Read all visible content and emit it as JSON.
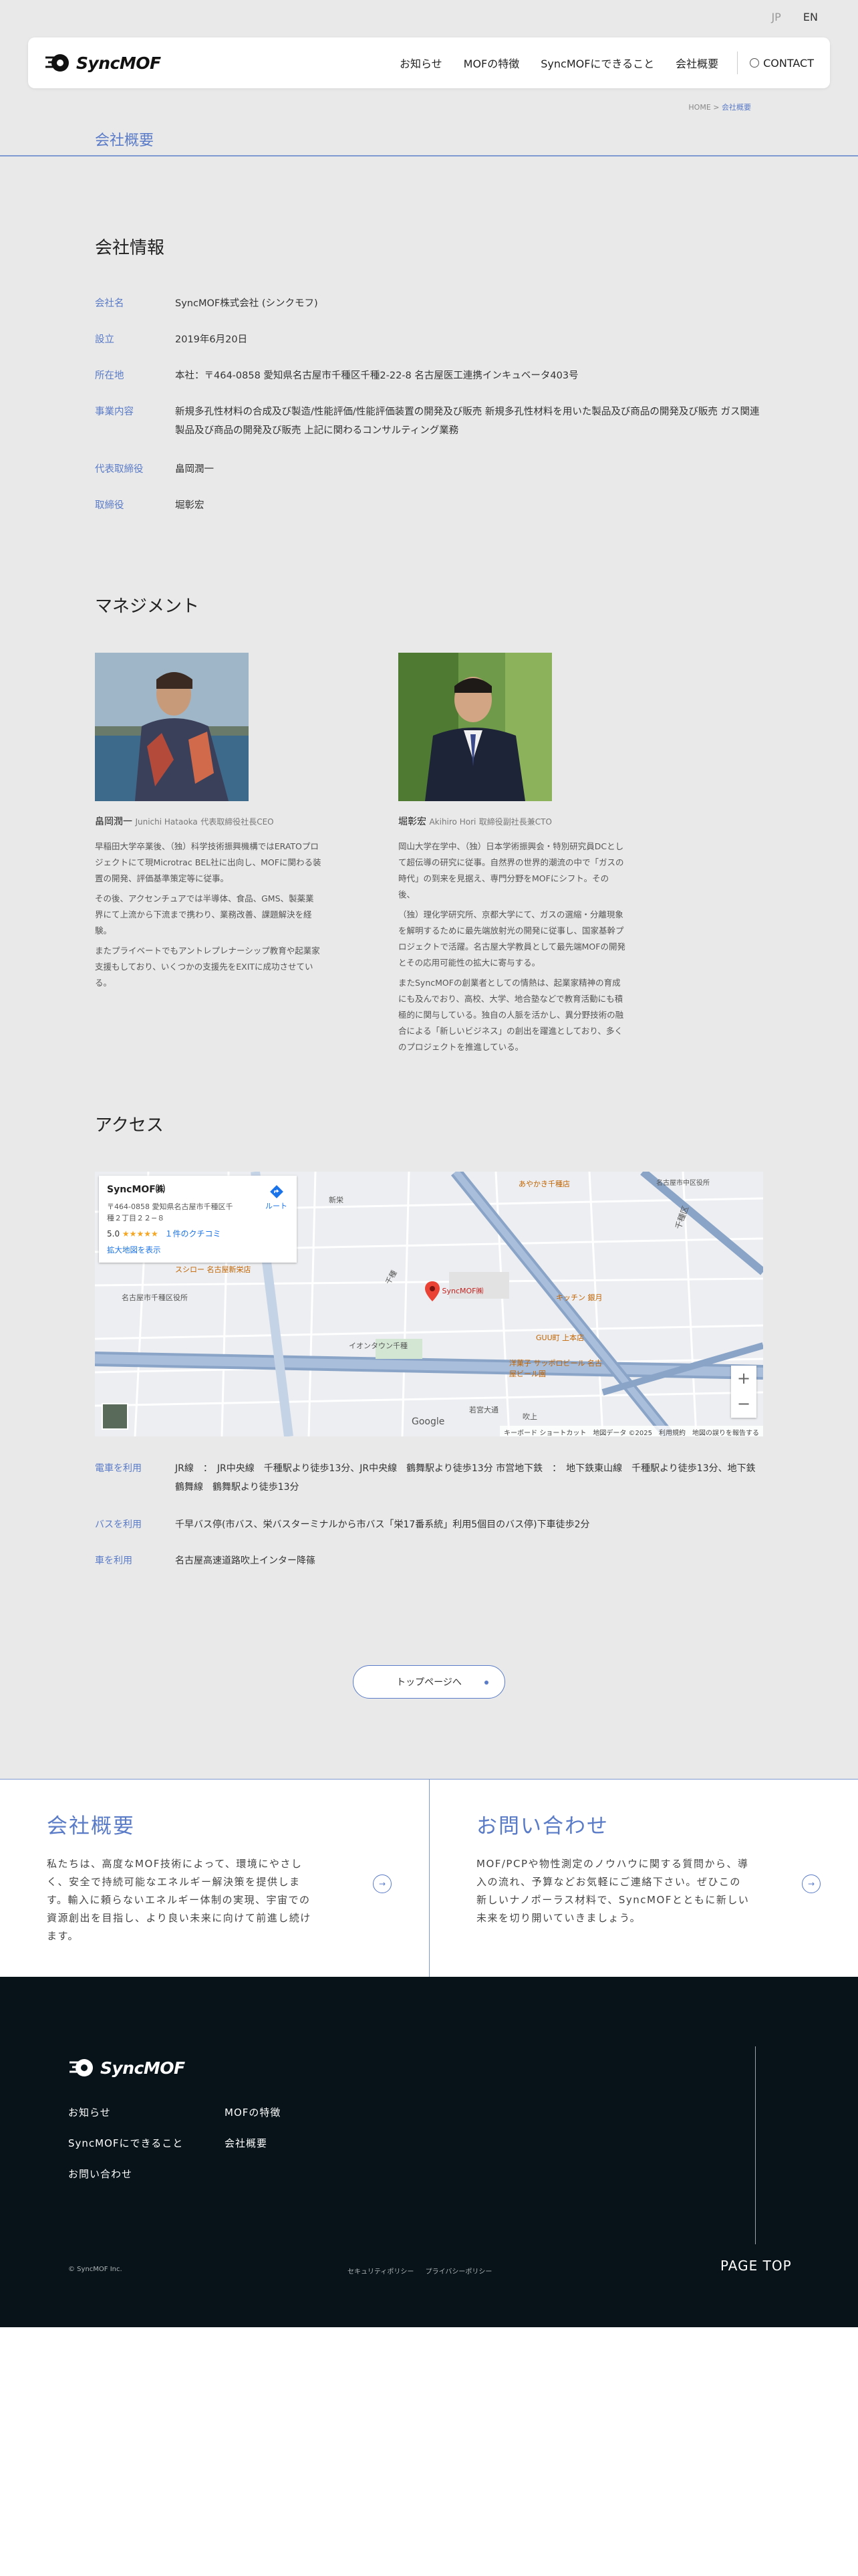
{
  "lang": {
    "jp": "JP",
    "en": "EN"
  },
  "header": {
    "logo_text": "SyncMOF",
    "nav": [
      "お知らせ",
      "MOFの特徴",
      "SyncMOFにできること",
      "会社概要"
    ],
    "contact": "CONTACT"
  },
  "breadcrumb": {
    "home": "HOME",
    "sep": ">",
    "current": "会社概要"
  },
  "page_title": "会社概要",
  "company": {
    "heading": "会社情報",
    "rows": [
      {
        "k": "会社名",
        "v": "SyncMOF株式会社 (シンクモフ)"
      },
      {
        "k": "設立",
        "v": "2019年6月20日"
      },
      {
        "k": "所在地",
        "v": "本社：〒464-0858 愛知県名古屋市千種区千種2-22-8 名古屋医工連携インキュベータ403号"
      },
      {
        "k": "事業内容",
        "v": "新規多孔性材料の合成及び製造/性能評価/性能評価装置の開発及び販売 新規多孔性材料を用いた製品及び商品の開発及び販売 ガス関連製品及び商品の開発及び販売 上記に関わるコンサルティング業務"
      },
      {
        "k": "代表取締役",
        "v": "畠岡潤一"
      },
      {
        "k": "取締役",
        "v": "堀彰宏"
      }
    ]
  },
  "management": {
    "heading": "マネジメント",
    "people": [
      {
        "name": "畠岡潤一",
        "en": "Junichi Hataoka",
        "role": "代表取締役社長CEO",
        "bio": [
          "早稲田大学卒業後、（独）科学技術振興機構ではERATOプロジェクトにて現Microtrac BEL社に出向し、MOFに関わる装置の開発、評価基準策定等に従事。",
          "その後、アクセンチュアでは半導体、食品、GMS、製薬業界にて上流から下流まで携わり、業務改善、課題解決を経験。",
          "またプライベートでもアントレプレナーシップ教育や起業家支援もしており、いくつかの支援先をEXITに成功させている。"
        ]
      },
      {
        "name": "堀彰宏",
        "en": "Akihiro Hori",
        "role": "取締役副社長兼CTO",
        "bio": [
          "岡山大学在学中、（独）日本学術振興会・特別研究員DCとして超伝導の研究に従事。自然界の世界的潮流の中で「ガスの時代」の到来を見据え、専門分野をMOFにシフト。その後、",
          "（独）理化学研究所、京都大学にて、ガスの選縮・分離現象を解明するために最先端放射光の開発に従事し、国家基幹プロジェクトで活躍。名古屋大学教員として最先端MOFの開発とその応用可能性の拡大に寄与する。",
          "またSyncMOFの創業者としての情熱は、起業家精神の育成にも及んでおり、高校、大学、地合塾などで教育活動にも積極的に関与している。独自の人脈を活かし、異分野技術の融合による「新しいビジネス」の創出を躍進としており、多くのプロジェクトを推進している。"
        ]
      }
    ]
  },
  "access": {
    "heading": "アクセス",
    "map": {
      "place": "SyncMOF㈱",
      "address": "〒464-0858 愛知県名古屋市千種区千種２丁目２２−８",
      "rating": "5.0",
      "stars": "★★★★★",
      "reviews": "１件のクチコミ",
      "large_map": "拡大地図を表示",
      "route": "ルート",
      "pin_label": "SyncMOF㈱",
      "labels": [
        "新栄",
        "葵",
        "千種",
        "名古屋市中区役所",
        "千種区",
        "イオンタウン千種",
        "若宮大通",
        "吹上",
        "名古屋市千種区役所",
        "あやかき千種店",
        "キッチン 銀月",
        "GUU町 上本店",
        "スシロー 名古屋新栄店",
        "洋菓子 サッポロビール 名古屋ビール園"
      ],
      "footer": [
        "キーボード ショートカット",
        "地図データ ©2025",
        "利用規約",
        "地図の誤りを報告する"
      ],
      "google": "Google"
    },
    "rows": [
      {
        "k": "電車を利用",
        "v": "JR線　：　JR中央線　千種駅より徒歩13分、JR中央線　鶴舞駅より徒歩13分 市営地下鉄　：　地下鉄東山線　千種駅より徒歩13分、地下鉄鶴舞線　鶴舞駅より徒歩13分"
      },
      {
        "k": "バスを利用",
        "v": "千早バス停(市バス、栄バスターミナルから市バス「栄17番系統」利用5個目のバス停)下車徒歩2分"
      },
      {
        "k": "車を利用",
        "v": "名古屋高速道路吹上インター降篠"
      }
    ]
  },
  "top_button": "トップページへ",
  "cta": [
    {
      "title": "会社概要",
      "desc": "私たちは、高度なMOF技術によって、環境にやさしく、安全で持続可能なエネルギー解決策を提供します。輸入に頼らないエネルギー体制の実現、宇宙での資源創出を目指し、より良い未来に向けて前進し続けます。"
    },
    {
      "title": "お問い合わせ",
      "desc": "MOF/PCPや物性測定のノウハウに関する質問から、導入の流れ、予算などお気軽にご連絡下さい。ぜひこの新しいナノポーラス材料で、SyncMOFとともに新しい未来を切り開いていきましょう。"
    }
  ],
  "footer": {
    "logo_text": "SyncMOF",
    "nav": [
      "お知らせ",
      "MOFの特徴",
      "SyncMOFにできること",
      "会社概要",
      "お問い合わせ"
    ],
    "copyright": "© SyncMOF Inc.",
    "links": [
      "セキュリティポリシー",
      "プライバシーポリシー"
    ],
    "page_top": "PAGE TOP"
  },
  "colors": {
    "accent": "#5a7bc7",
    "gray_bg": "#e9e9e9",
    "footer_bg": "#071318"
  }
}
